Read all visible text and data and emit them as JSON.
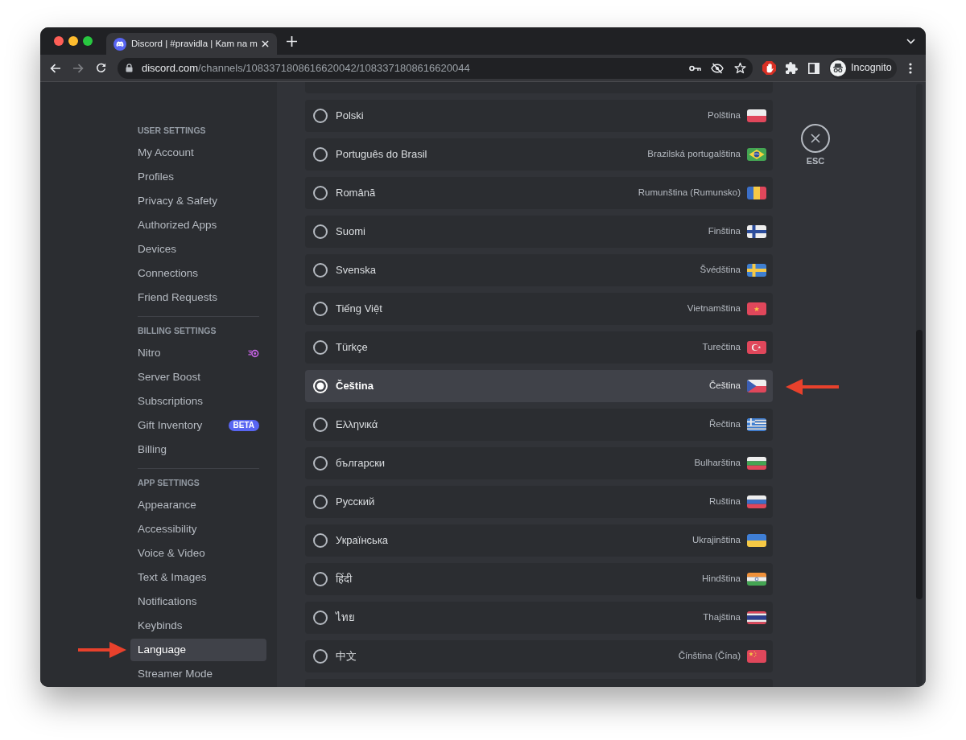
{
  "browser": {
    "tab": {
      "title": "Discord | #pravidla | Kam na m"
    },
    "address_bar": {
      "host": "discord.com",
      "path": "/channels/1083371808616620042/1083371808616620044"
    },
    "profile": {
      "label": "Incognito"
    }
  },
  "sidebar": {
    "sections": [
      {
        "header": "USER SETTINGS",
        "items": [
          {
            "label": "My Account",
            "kind": "plain",
            "selected": false
          },
          {
            "label": "Profiles",
            "kind": "plain",
            "selected": false
          },
          {
            "label": "Privacy & Safety",
            "kind": "plain",
            "selected": false
          },
          {
            "label": "Authorized Apps",
            "kind": "plain",
            "selected": false
          },
          {
            "label": "Devices",
            "kind": "plain",
            "selected": false
          },
          {
            "label": "Connections",
            "kind": "plain",
            "selected": false
          },
          {
            "label": "Friend Requests",
            "kind": "plain",
            "selected": false
          }
        ]
      },
      {
        "header": "BILLING SETTINGS",
        "items": [
          {
            "label": "Nitro",
            "kind": "icon",
            "selected": false
          },
          {
            "label": "Server Boost",
            "kind": "plain",
            "selected": false
          },
          {
            "label": "Subscriptions",
            "kind": "plain",
            "selected": false
          },
          {
            "label": "Gift Inventory",
            "kind": "badge",
            "badge": "BETA",
            "selected": false
          },
          {
            "label": "Billing",
            "kind": "plain",
            "selected": false
          }
        ]
      },
      {
        "header": "APP SETTINGS",
        "items": [
          {
            "label": "Appearance",
            "kind": "plain",
            "selected": false
          },
          {
            "label": "Accessibility",
            "kind": "plain",
            "selected": false
          },
          {
            "label": "Voice & Video",
            "kind": "plain",
            "selected": false
          },
          {
            "label": "Text & Images",
            "kind": "plain",
            "selected": false
          },
          {
            "label": "Notifications",
            "kind": "plain",
            "selected": false
          },
          {
            "label": "Keybinds",
            "kind": "plain",
            "selected": false
          },
          {
            "label": "Language",
            "kind": "plain",
            "selected": true
          },
          {
            "label": "Streamer Mode",
            "kind": "plain",
            "selected": false
          }
        ]
      }
    ]
  },
  "language_list": {
    "options": [
      {
        "name": "Polski",
        "translation": "Polština",
        "selected": false
      },
      {
        "name": "Português do Brasil",
        "translation": "Brazilská portugalština",
        "selected": false
      },
      {
        "name": "Română",
        "translation": "Rumunština (Rumunsko)",
        "selected": false
      },
      {
        "name": "Suomi",
        "translation": "Finština",
        "selected": false
      },
      {
        "name": "Svenska",
        "translation": "Švédština",
        "selected": false
      },
      {
        "name": "Tiếng Việt",
        "translation": "Vietnamština",
        "selected": false
      },
      {
        "name": "Türkçe",
        "translation": "Turečtina",
        "selected": false
      },
      {
        "name": "Čeština",
        "translation": "Čeština",
        "selected": true
      },
      {
        "name": "Ελληνικά",
        "translation": "Řečtina",
        "selected": false
      },
      {
        "name": "български",
        "translation": "Bulharština",
        "selected": false
      },
      {
        "name": "Русский",
        "translation": "Ruština",
        "selected": false
      },
      {
        "name": "Українська",
        "translation": "Ukrajinština",
        "selected": false
      },
      {
        "name": "हिंदी",
        "translation": "Hindština",
        "selected": false
      },
      {
        "name": "ไทย",
        "translation": "Thajština",
        "selected": false
      },
      {
        "name": "中文",
        "translation": "Čínština (Čína)",
        "selected": false
      }
    ]
  },
  "close_button": {
    "label": "ESC"
  }
}
